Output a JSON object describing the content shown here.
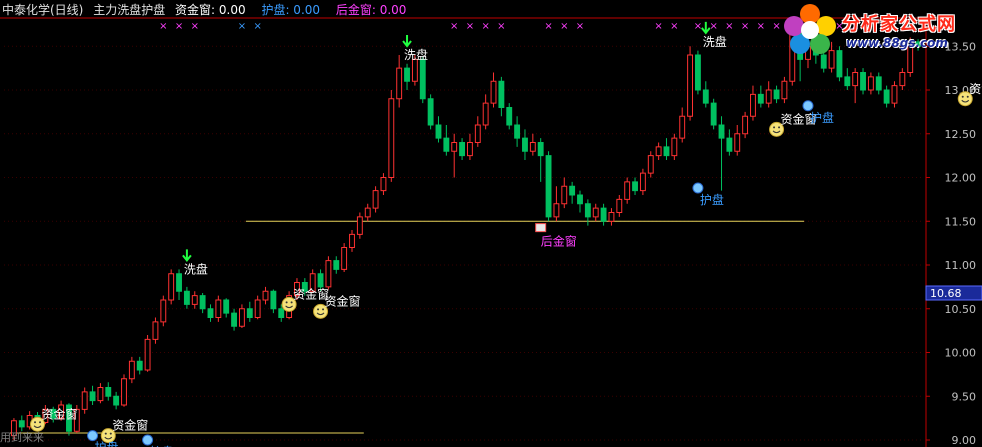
{
  "header": {
    "title": "中泰化学(日线)",
    "indicator": "主力洗盘护盘",
    "fund_label": "资金窗: 0.00",
    "guard_label": "护盘: 0.00",
    "post_label": "后金窗: 0.00"
  },
  "logo": {
    "text": "分析家公式网",
    "url": "www.88gs.com"
  },
  "colors": {
    "up": "#ff3232",
    "down": "#00c060",
    "fund": "#ffffff",
    "guard": "#3a9cff",
    "post": "#ff40ff",
    "axis": "#c00000",
    "price_tag_bg": "#1a2a9a",
    "support": "#e6d25a"
  },
  "bottom_text": "用到来来",
  "price_tag": "10.68",
  "chart_data": {
    "type": "candlestick",
    "ylim": [
      9.0,
      13.8
    ],
    "yticks": [
      "13.50",
      "13.00",
      "12.50",
      "12.00",
      "11.50",
      "11.00",
      "10.50",
      "10.00",
      "9.50",
      "9.00"
    ],
    "candles": [
      [
        9.05,
        9.22,
        9.0,
        9.25
      ],
      [
        9.22,
        9.15,
        9.1,
        9.28
      ],
      [
        9.15,
        9.28,
        9.12,
        9.33
      ],
      [
        9.28,
        9.2,
        9.15,
        9.32
      ],
      [
        9.2,
        9.35,
        9.18,
        9.4
      ],
      [
        9.35,
        9.25,
        9.2,
        9.38
      ],
      [
        9.25,
        9.4,
        9.22,
        9.45
      ],
      [
        9.4,
        9.1,
        9.05,
        9.42
      ],
      [
        9.1,
        9.35,
        9.08,
        9.4
      ],
      [
        9.35,
        9.55,
        9.3,
        9.6
      ],
      [
        9.55,
        9.45,
        9.4,
        9.62
      ],
      [
        9.45,
        9.6,
        9.42,
        9.65
      ],
      [
        9.6,
        9.5,
        9.45,
        9.66
      ],
      [
        9.5,
        9.4,
        9.35,
        9.55
      ],
      [
        9.4,
        9.7,
        9.38,
        9.75
      ],
      [
        9.7,
        9.9,
        9.65,
        9.95
      ],
      [
        9.9,
        9.8,
        9.75,
        9.95
      ],
      [
        9.8,
        10.15,
        9.78,
        10.2
      ],
      [
        10.15,
        10.35,
        10.1,
        10.4
      ],
      [
        10.35,
        10.6,
        10.3,
        10.65
      ],
      [
        10.6,
        10.9,
        10.55,
        10.95
      ],
      [
        10.9,
        10.7,
        10.6,
        10.95
      ],
      [
        10.7,
        10.55,
        10.5,
        10.75
      ],
      [
        10.55,
        10.65,
        10.5,
        10.7
      ],
      [
        10.65,
        10.5,
        10.45,
        10.68
      ],
      [
        10.5,
        10.4,
        10.35,
        10.55
      ],
      [
        10.4,
        10.6,
        10.35,
        10.65
      ],
      [
        10.6,
        10.45,
        10.4,
        10.62
      ],
      [
        10.45,
        10.3,
        10.25,
        10.5
      ],
      [
        10.3,
        10.5,
        10.28,
        10.55
      ],
      [
        10.5,
        10.4,
        10.35,
        10.58
      ],
      [
        10.4,
        10.6,
        10.38,
        10.65
      ],
      [
        10.6,
        10.7,
        10.55,
        10.75
      ],
      [
        10.7,
        10.5,
        10.45,
        10.72
      ],
      [
        10.5,
        10.4,
        10.35,
        10.55
      ],
      [
        10.4,
        10.65,
        10.38,
        10.7
      ],
      [
        10.65,
        10.8,
        10.6,
        10.85
      ],
      [
        10.8,
        10.7,
        10.65,
        10.85
      ],
      [
        10.7,
        10.9,
        10.68,
        10.95
      ],
      [
        10.9,
        10.75,
        10.7,
        10.95
      ],
      [
        10.75,
        11.05,
        10.72,
        11.1
      ],
      [
        11.05,
        10.95,
        10.9,
        11.1
      ],
      [
        10.95,
        11.2,
        10.92,
        11.25
      ],
      [
        11.2,
        11.35,
        11.15,
        11.4
      ],
      [
        11.35,
        11.55,
        11.3,
        11.6
      ],
      [
        11.55,
        11.65,
        11.5,
        11.7
      ],
      [
        11.65,
        11.85,
        11.6,
        11.9
      ],
      [
        11.85,
        12.0,
        11.8,
        12.05
      ],
      [
        12.0,
        12.9,
        11.95,
        13.0
      ],
      [
        12.9,
        13.25,
        12.8,
        13.4
      ],
      [
        13.25,
        13.1,
        13.0,
        13.3
      ],
      [
        13.1,
        13.35,
        13.05,
        13.4
      ],
      [
        13.35,
        12.9,
        12.85,
        13.38
      ],
      [
        12.9,
        12.6,
        12.55,
        12.95
      ],
      [
        12.6,
        12.45,
        12.4,
        12.7
      ],
      [
        12.45,
        12.3,
        12.25,
        12.6
      ],
      [
        12.3,
        12.4,
        12.0,
        12.5
      ],
      [
        12.4,
        12.25,
        12.2,
        12.45
      ],
      [
        12.25,
        12.4,
        12.2,
        12.5
      ],
      [
        12.4,
        12.6,
        12.35,
        12.7
      ],
      [
        12.6,
        12.85,
        12.55,
        12.95
      ],
      [
        12.85,
        13.1,
        12.8,
        13.2
      ],
      [
        13.1,
        12.8,
        12.7,
        13.15
      ],
      [
        12.8,
        12.6,
        12.55,
        12.85
      ],
      [
        12.6,
        12.45,
        12.35,
        12.7
      ],
      [
        12.45,
        12.3,
        12.2,
        12.55
      ],
      [
        12.3,
        12.4,
        12.25,
        12.5
      ],
      [
        12.4,
        12.25,
        11.95,
        12.45
      ],
      [
        12.25,
        11.55,
        11.5,
        12.3
      ],
      [
        11.55,
        11.7,
        11.5,
        11.9
      ],
      [
        11.7,
        11.9,
        11.65,
        12.0
      ],
      [
        11.9,
        11.8,
        11.7,
        11.95
      ],
      [
        11.8,
        11.7,
        11.6,
        11.85
      ],
      [
        11.7,
        11.55,
        11.45,
        11.75
      ],
      [
        11.55,
        11.65,
        11.5,
        11.7
      ],
      [
        11.65,
        11.5,
        11.45,
        11.7
      ],
      [
        11.5,
        11.6,
        11.45,
        11.65
      ],
      [
        11.6,
        11.75,
        11.55,
        11.8
      ],
      [
        11.75,
        11.95,
        11.7,
        12.0
      ],
      [
        11.95,
        11.85,
        11.8,
        12.0
      ],
      [
        11.85,
        12.05,
        11.8,
        12.1
      ],
      [
        12.05,
        12.25,
        12.0,
        12.3
      ],
      [
        12.25,
        12.35,
        12.2,
        12.4
      ],
      [
        12.35,
        12.25,
        12.2,
        12.45
      ],
      [
        12.25,
        12.45,
        12.2,
        12.5
      ],
      [
        12.45,
        12.7,
        12.4,
        12.8
      ],
      [
        12.7,
        13.4,
        12.65,
        13.5
      ],
      [
        13.4,
        13.0,
        12.95,
        13.45
      ],
      [
        13.0,
        12.85,
        12.8,
        13.1
      ],
      [
        12.85,
        12.6,
        12.55,
        12.9
      ],
      [
        12.6,
        12.45,
        11.85,
        12.7
      ],
      [
        12.45,
        12.3,
        12.25,
        12.55
      ],
      [
        12.3,
        12.5,
        12.25,
        12.6
      ],
      [
        12.5,
        12.7,
        12.45,
        12.75
      ],
      [
        12.7,
        12.95,
        12.65,
        13.05
      ],
      [
        12.95,
        12.85,
        12.8,
        13.05
      ],
      [
        12.85,
        13.0,
        12.8,
        13.1
      ],
      [
        13.0,
        12.9,
        12.85,
        13.05
      ],
      [
        12.9,
        13.1,
        12.85,
        13.15
      ],
      [
        13.1,
        13.75,
        13.05,
        13.8
      ],
      [
        13.75,
        13.35,
        13.1,
        13.78
      ],
      [
        13.35,
        13.5,
        13.25,
        13.6
      ],
      [
        13.5,
        13.4,
        13.3,
        13.55
      ],
      [
        13.4,
        13.25,
        13.2,
        13.5
      ],
      [
        13.25,
        13.45,
        13.2,
        13.55
      ],
      [
        13.45,
        13.15,
        13.1,
        13.5
      ],
      [
        13.15,
        13.05,
        13.0,
        13.25
      ],
      [
        13.05,
        13.2,
        12.85,
        13.25
      ],
      [
        13.2,
        13.0,
        12.95,
        13.25
      ],
      [
        13.0,
        13.15,
        12.95,
        13.2
      ],
      [
        13.15,
        13.0,
        12.95,
        13.2
      ],
      [
        13.0,
        12.85,
        12.8,
        13.05
      ],
      [
        12.85,
        13.05,
        12.8,
        13.1
      ],
      [
        13.05,
        13.2,
        13.0,
        13.25
      ],
      [
        13.2,
        13.55,
        13.15,
        13.6
      ],
      [
        13.55,
        13.5,
        13.45,
        13.58
      ]
    ],
    "support_lines": [
      {
        "y": 9.08,
        "from": 0,
        "to": 44
      },
      {
        "y": 11.5,
        "from": 30,
        "to": 100
      }
    ],
    "annotations": [
      {
        "label": "资金窗",
        "type": "fund",
        "i": 3,
        "y": 9.18
      },
      {
        "label": "资金窗",
        "type": "fund",
        "i": 12,
        "y": 9.05
      },
      {
        "label": "护盘",
        "type": "guard",
        "i": 10,
        "y": 9.05
      },
      {
        "label": "护盘",
        "type": "guard",
        "i": 17,
        "y": 9.0
      },
      {
        "label": "洗盘",
        "type": "wash",
        "i": 22,
        "y": 10.95
      },
      {
        "label": "资金窗",
        "type": "fund",
        "i": 35,
        "y": 10.55
      },
      {
        "label": "资金窗",
        "type": "fund",
        "i": 39,
        "y": 10.47
      },
      {
        "label": "洗盘",
        "type": "wash",
        "i": 50,
        "y": 13.4
      },
      {
        "label": "后金窗",
        "type": "post",
        "i": 67,
        "y": 11.45
      },
      {
        "label": "护盘",
        "type": "guard",
        "i": 87,
        "y": 11.88
      },
      {
        "label": "洗盘",
        "type": "wash",
        "i": 88,
        "y": 13.55
      },
      {
        "label": "资金窗",
        "type": "fund",
        "i": 97,
        "y": 12.55
      },
      {
        "label": "护盘",
        "type": "guard",
        "i": 101,
        "y": 12.82
      },
      {
        "label": "资金窗",
        "type": "fund",
        "i": 121,
        "y": 12.9
      }
    ],
    "marker_groups": [
      {
        "from": 19,
        "to": 24,
        "color": "post"
      },
      {
        "from": 29,
        "to": 32,
        "color": "guard"
      },
      {
        "from": 56,
        "to": 63,
        "color": "post"
      },
      {
        "from": 68,
        "to": 72,
        "color": "post"
      },
      {
        "from": 82,
        "to": 85,
        "color": "post"
      },
      {
        "from": 87,
        "to": 97,
        "color": "post"
      },
      {
        "from": 101,
        "to": 107,
        "color": "post"
      }
    ]
  }
}
